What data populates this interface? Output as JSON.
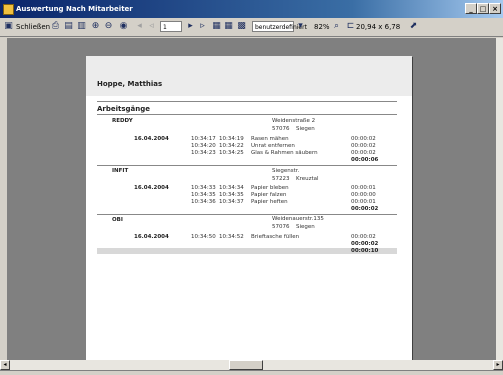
{
  "window": {
    "title": "Auswertung Nach Mitarbeiter"
  },
  "toolbar": {
    "close_label": "Schließen",
    "page_number": "1",
    "zoom_mode": "benutzerdefiniert",
    "zoom_percent": "82%",
    "page_size": "20,94 x 6,78"
  },
  "report": {
    "employee": "Hoppe, Matthias",
    "section_title": "Arbeitsgänge",
    "customers": [
      {
        "name": "REDDY",
        "street": "Weidenstraße 2",
        "zip": "57076",
        "city": "Siegen",
        "date": "16.04.2004",
        "rows": [
          {
            "start": "10:34:17",
            "end": "10:34:19",
            "task": "Rasen mähen",
            "duration": "00:00:02"
          },
          {
            "start": "10:34:20",
            "end": "10:34:22",
            "task": "Unrat entfernen",
            "duration": "00:00:02"
          },
          {
            "start": "10:34:23",
            "end": "10:34:25",
            "task": "Glas & Rahmen säubern",
            "duration": "00:00:02"
          }
        ],
        "total": "00:00:06"
      },
      {
        "name": "INFIT",
        "street": "Siegenstr.",
        "zip": "57223",
        "city": "Kreuztal",
        "date": "16.04.2004",
        "rows": [
          {
            "start": "10:34:33",
            "end": "10:34:34",
            "task": "Papier bleben",
            "duration": "00:00:01"
          },
          {
            "start": "10:34:35",
            "end": "10:34:35",
            "task": "Papier falzen",
            "duration": "00:00:00"
          },
          {
            "start": "10:34:36",
            "end": "10:34:37",
            "task": "Papier heften",
            "duration": "00:00:01"
          }
        ],
        "total": "00:00:02"
      },
      {
        "name": "OBI",
        "street": "Weidenauerstr.135",
        "zip": "57076",
        "city": "Siegen",
        "date": "16.04.2004",
        "rows": [
          {
            "start": "10:34:50",
            "end": "10:34:52",
            "task": "Brieftasche füllen",
            "duration": "00:00:02"
          }
        ],
        "total": "00:00:02"
      }
    ],
    "grand_total": "00:00:10"
  }
}
